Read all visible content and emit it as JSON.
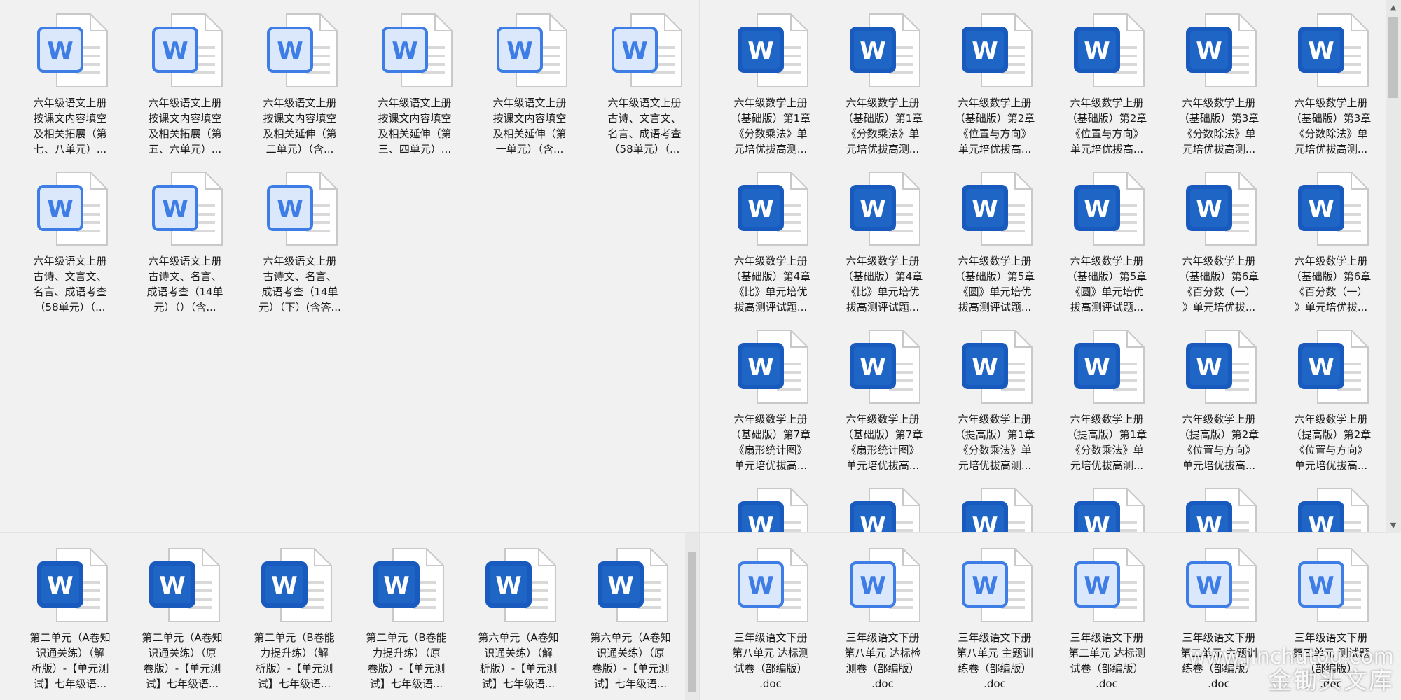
{
  "panels": [
    {
      "id": "panel-tl",
      "icon_style": "light",
      "files": [
        {
          "label": "六年级语文上册\n按课文内容填空\n及相关拓展（第\n七、八单元）..."
        },
        {
          "label": "六年级语文上册\n按课文内容填空\n及相关拓展（第\n五、六单元）..."
        },
        {
          "label": "六年级语文上册\n按课文内容填空\n及相关延伸（第\n二单元）（含..."
        },
        {
          "label": "六年级语文上册\n按课文内容填空\n及相关延伸（第\n三、四单元）..."
        },
        {
          "label": "六年级语文上册\n按课文内容填空\n及相关延伸（第\n一单元）（含..."
        },
        {
          "label": "六年级语文上册\n古诗、文言文、\n名言、成语考查\n（58单元）（..."
        },
        {
          "label": "六年级语文上册\n古诗、文言文、\n名言、成语考查\n（58单元）（..."
        },
        {
          "label": "六年级语文上册\n古诗文、名言、\n成语考查（14单\n元）（）（含..."
        },
        {
          "label": "六年级语文上册\n古诗文、名言、\n成语考查（14单\n元）（下）(含答..."
        }
      ]
    },
    {
      "id": "panel-tr",
      "icon_style": "dark",
      "files": [
        {
          "label": "六年级数学上册\n（基础版）第1章\n《分数乘法》单\n元培优拔高测..."
        },
        {
          "label": "六年级数学上册\n（基础版）第1章\n《分数乘法》单\n元培优拔高测..."
        },
        {
          "label": "六年级数学上册\n（基础版）第2章\n《位置与方向》\n单元培优拔高..."
        },
        {
          "label": "六年级数学上册\n（基础版）第2章\n《位置与方向》\n单元培优拔高..."
        },
        {
          "label": "六年级数学上册\n（基础版）第3章\n《分数除法》单\n元培优拔高测..."
        },
        {
          "label": "六年级数学上册\n（基础版）第3章\n《分数除法》单\n元培优拔高测..."
        },
        {
          "label": "六年级数学上册\n（基础版）第4章\n《比》单元培优\n拔高测评试题..."
        },
        {
          "label": "六年级数学上册\n（基础版）第4章\n《比》单元培优\n拔高测评试题..."
        },
        {
          "label": "六年级数学上册\n（基础版）第5章\n《圆》单元培优\n拔高测评试题..."
        },
        {
          "label": "六年级数学上册\n（基础版）第5章\n《圆》单元培优\n拔高测评试题..."
        },
        {
          "label": "六年级数学上册\n（基础版）第6章\n《百分数（一）\n》单元培优拔..."
        },
        {
          "label": "六年级数学上册\n（基础版）第6章\n《百分数（一）\n》单元培优拔..."
        },
        {
          "label": "六年级数学上册\n（基础版）第7章\n《扇形统计图》\n单元培优拔高..."
        },
        {
          "label": "六年级数学上册\n（基础版）第7章\n《扇形统计图》\n单元培优拔高..."
        },
        {
          "label": "六年级数学上册\n（提高版）第1章\n《分数乘法》单\n元培优拔高测..."
        },
        {
          "label": "六年级数学上册\n（提高版）第1章\n《分数乘法》单\n元培优拔高测..."
        },
        {
          "label": "六年级数学上册\n（提高版）第2章\n《位置与方向》\n单元培优拔高..."
        },
        {
          "label": "六年级数学上册\n（提高版）第2章\n《位置与方向》\n单元培优拔高..."
        },
        {
          "label": ""
        },
        {
          "label": ""
        },
        {
          "label": ""
        },
        {
          "label": ""
        },
        {
          "label": ""
        },
        {
          "label": ""
        }
      ]
    },
    {
      "id": "panel-bl",
      "icon_style": "dark",
      "files": [
        {
          "label": "第二单元（A卷知\n识通关练）（解\n析版）-【单元测\n试】七年级语..."
        },
        {
          "label": "第二单元（A卷知\n识通关练）（原\n卷版）-【单元测\n试】七年级语..."
        },
        {
          "label": "第二单元（B卷能\n力提升练）（解\n析版）-【单元测\n试】七年级语..."
        },
        {
          "label": "第二单元（B卷能\n力提升练）（原\n卷版）-【单元测\n试】七年级语..."
        },
        {
          "label": "第六单元（A卷知\n识通关练）（解\n析版）-【单元测\n试】七年级语..."
        },
        {
          "label": "第六单元（A卷知\n识通关练）（原\n卷版）-【单元测\n试】七年级语..."
        }
      ]
    },
    {
      "id": "panel-br",
      "icon_style": "light",
      "files": [
        {
          "label": "三年级语文下册\n第八单元 达标测\n试卷（部编版）\n.doc"
        },
        {
          "label": "三年级语文下册\n第八单元 达标检\n测卷（部编版）\n.doc"
        },
        {
          "label": "三年级语文下册\n第八单元 主题训\n练卷（部编版）\n.doc"
        },
        {
          "label": "三年级语文下册\n第二单元 达标测\n试卷（部编版）\n.doc"
        },
        {
          "label": "三年级语文下册\n第二单元 主题训\n练卷（部编版）\n.doc"
        },
        {
          "label": "三年级语文下册\n第三单元 测试题\n（部编版）\n.doc"
        }
      ]
    }
  ],
  "icon": {
    "letter": "W",
    "light_blue": "#3d7de5",
    "dark_blue": "#185abd",
    "dark_blue_mid": "#2b7cd3",
    "page_fill": "#ffffff",
    "page_line": "#c9c9c9"
  },
  "watermark": {
    "url": "www.jinchutou.com",
    "text": "金锄头文库"
  }
}
